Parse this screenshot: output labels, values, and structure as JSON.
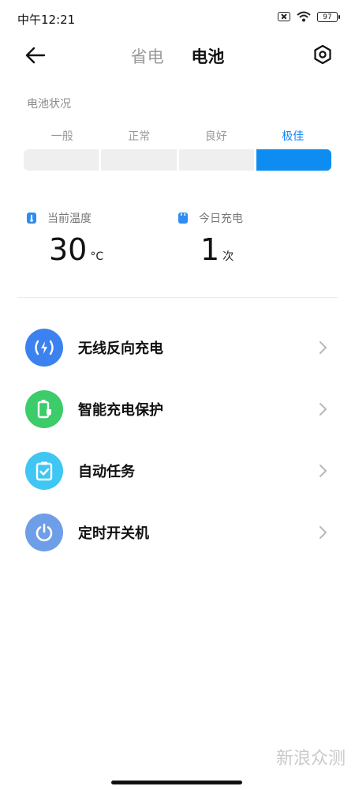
{
  "status_bar": {
    "time": "中午12:21",
    "battery": "97"
  },
  "header": {
    "tabs": [
      {
        "label": "省电"
      },
      {
        "label": "电池"
      }
    ]
  },
  "battery_status": {
    "title": "电池状况",
    "levels": [
      "一般",
      "正常",
      "良好",
      "极佳"
    ],
    "current": "极佳",
    "accent": "#0d8cf2"
  },
  "stats": {
    "temperature": {
      "label": "当前温度",
      "value": "30",
      "unit": "°C"
    },
    "charges": {
      "label": "今日充电",
      "value": "1",
      "unit": "次"
    }
  },
  "menu": [
    {
      "label": "无线反向充电",
      "icon": "wireless-charging-icon",
      "color": "#3b82f0"
    },
    {
      "label": "智能充电保护",
      "icon": "battery-shield-icon",
      "color": "#3ccc6a"
    },
    {
      "label": "自动任务",
      "icon": "clipboard-check-icon",
      "color": "#3fc6f3"
    },
    {
      "label": "定时开关机",
      "icon": "power-icon",
      "color": "#6f9ee8"
    }
  ],
  "watermark": "新浪众测"
}
